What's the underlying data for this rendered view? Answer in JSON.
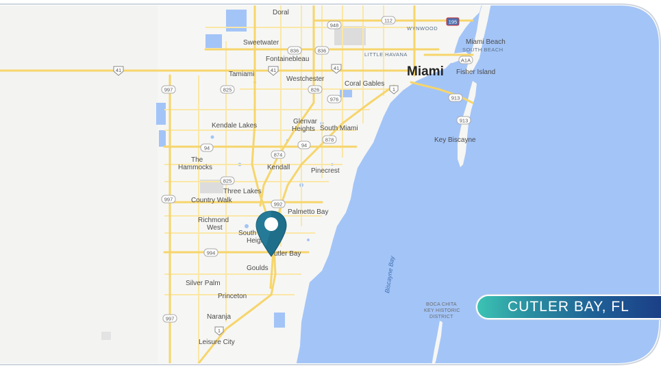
{
  "location_banner": "CUTLER BAY, FL",
  "marker_icon": "map-pin-icon",
  "colors": {
    "water": "#a3c4f7",
    "land": "#f6f6f4",
    "road_major": "#f6d56b",
    "road_minor": "#fbe7a6",
    "pin": "#1f6f8b",
    "banner_start": "#3cc3b4",
    "banner_end": "#1b3f86"
  },
  "place_labels": {
    "doral": "Doral",
    "wynwood": "WYNWOOD",
    "sweetwater": "Sweetwater",
    "miami_beach": "Miami Beach",
    "south_beach": "SOUTH BEACH",
    "little_havana": "LITTLE HAVANA",
    "fontainebleau": "Fontainebleau",
    "miami": "Miami",
    "fisher_island": "Fisher Island",
    "tamiami": "Tamiami",
    "westchester": "Westchester",
    "coral_gables": "Coral Gables",
    "kendale_lakes": "Kendale Lakes",
    "glenvar_heights_1": "Glenvar",
    "glenvar_heights_2": "Heights",
    "south_miami": "South Miami",
    "key_biscayne": "Key Biscayne",
    "the_hammocks_1": "The",
    "the_hammocks_2": "Hammocks",
    "kendall": "Kendall",
    "pinecrest": "Pinecrest",
    "three_lakes": "Three Lakes",
    "country_walk": "Country Walk",
    "palmetto_bay": "Palmetto Bay",
    "richmond_west_1": "Richmond",
    "richmond_west_2": "West",
    "south_heights_1": "South",
    "south_heights_2": "Heigh",
    "cutler_bay": "utler Bay",
    "goulds": "Goulds",
    "silver_palm": "Silver Palm",
    "princeton": "Princeton",
    "naranja": "Naranja",
    "leisure_city": "Leisure City",
    "biscayne_bay": "Biscayne Bay",
    "boca_chita_1": "BOCA CHITA",
    "boca_chita_2": "KEY HISTORIC",
    "boca_chita_3": "DISTRICT"
  },
  "route_shields": {
    "s112": "112",
    "s948": "948",
    "s195": "195",
    "s836": "836",
    "s836b": "836",
    "sA1A": "A1A",
    "s41a": "41",
    "s41b": "41",
    "s41c": "41",
    "s997a": "997",
    "s825a": "825",
    "s826": "826",
    "s976": "976",
    "s1a": "1",
    "s913a": "913",
    "s913b": "913",
    "s94a": "94",
    "s874": "874",
    "s94b": "94",
    "s878": "878",
    "s825b": "825",
    "s997b": "997",
    "s992": "992",
    "s994": "994",
    "s997c": "997",
    "s1b": "1"
  }
}
